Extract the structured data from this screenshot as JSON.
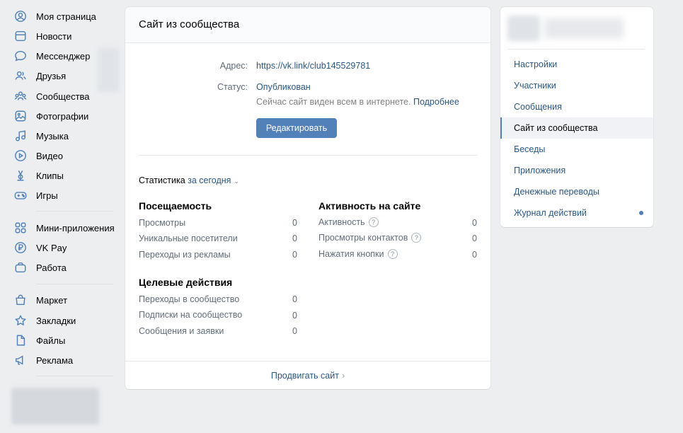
{
  "sidebar": {
    "items": [
      {
        "label": "Моя страница",
        "icon": "user-circle-icon"
      },
      {
        "label": "Новости",
        "icon": "news-icon"
      },
      {
        "label": "Мессенджер",
        "icon": "message-icon"
      },
      {
        "label": "Друзья",
        "icon": "friends-icon"
      },
      {
        "label": "Сообщества",
        "icon": "communities-icon"
      },
      {
        "label": "Фотографии",
        "icon": "photo-icon"
      },
      {
        "label": "Музыка",
        "icon": "music-icon"
      },
      {
        "label": "Видео",
        "icon": "video-icon"
      },
      {
        "label": "Клипы",
        "icon": "clips-icon"
      },
      {
        "label": "Игры",
        "icon": "gamepad-icon"
      },
      {
        "label": "Мини-приложения",
        "icon": "apps-icon"
      },
      {
        "label": "VK Pay",
        "icon": "vkpay-icon"
      },
      {
        "label": "Работа",
        "icon": "briefcase-icon"
      },
      {
        "label": "Маркет",
        "icon": "shopping-bag-icon"
      },
      {
        "label": "Закладки",
        "icon": "star-icon"
      },
      {
        "label": "Файлы",
        "icon": "file-icon"
      },
      {
        "label": "Реклама",
        "icon": "megaphone-icon"
      }
    ]
  },
  "main": {
    "title": "Сайт из сообщества",
    "address_label": "Адрес:",
    "address_value": "https://vk.link/club145529781",
    "status_label": "Статус:",
    "status_value": "Опубликован",
    "status_hint": "Сейчас сайт виден всем в интернете.",
    "status_more": "Подробнее",
    "edit_button": "Редактировать",
    "stats_label": "Статистика",
    "stats_period": "за сегодня",
    "attendance": {
      "title": "Посещаемость",
      "rows": [
        {
          "label": "Просмотры",
          "value": "0"
        },
        {
          "label": "Уникальные посетители",
          "value": "0"
        },
        {
          "label": "Переходы из рекламы",
          "value": "0"
        }
      ]
    },
    "activity": {
      "title": "Активность на сайте",
      "rows": [
        {
          "label": "Активность",
          "value": "0"
        },
        {
          "label": "Просмотры контактов",
          "value": "0"
        },
        {
          "label": "Нажатия кнопки",
          "value": "0"
        }
      ]
    },
    "targets": {
      "title": "Целевые действия",
      "rows": [
        {
          "label": "Переходы в сообщество",
          "value": "0"
        },
        {
          "label": "Подписки на сообщество",
          "value": "0"
        },
        {
          "label": "Сообщения и заявки",
          "value": "0"
        }
      ]
    },
    "promote_link": "Продвигать сайт"
  },
  "right_menu": {
    "items": [
      {
        "label": "Настройки"
      },
      {
        "label": "Участники"
      },
      {
        "label": "Сообщения"
      },
      {
        "label": "Сайт из сообщества"
      },
      {
        "label": "Беседы"
      },
      {
        "label": "Приложения"
      },
      {
        "label": "Денежные переводы"
      },
      {
        "label": "Журнал действий"
      }
    ],
    "active_index": 3,
    "accent_color": "#5181b8"
  }
}
